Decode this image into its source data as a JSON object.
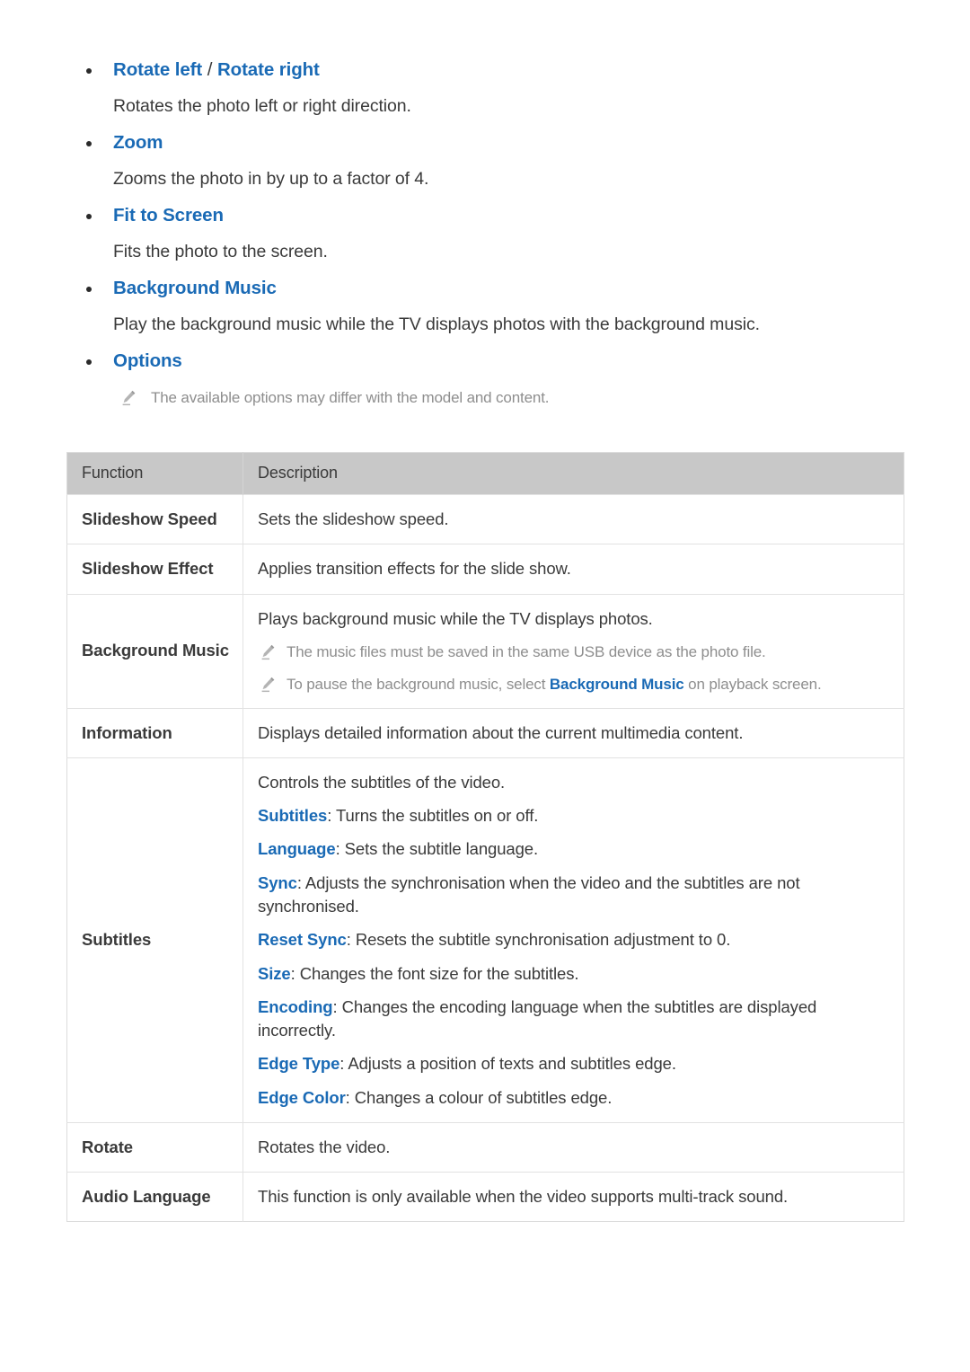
{
  "colors": {
    "accent_blue": "#1a6ab5",
    "body_text": "#3a3a3a",
    "note_text": "#8e8e8e",
    "table_header_bg": "#c8c8c8",
    "table_border": "#e2e2e2"
  },
  "sections": [
    {
      "title_a": "Rotate left",
      "separator": " / ",
      "title_b": "Rotate right",
      "body": "Rotates the photo left or right direction."
    },
    {
      "title_a": "Zoom",
      "body": "Zooms the photo in by up to a factor of 4."
    },
    {
      "title_a": "Fit to Screen",
      "body": "Fits the photo to the screen."
    },
    {
      "title_a": "Background Music",
      "body": "Play the background music while the TV displays photos with the background music."
    },
    {
      "title_a": "Options",
      "note": "The available options may differ with the model and content."
    }
  ],
  "table": {
    "headers": [
      "Function",
      "Description"
    ],
    "rows": [
      {
        "function": "Slideshow Speed",
        "lines": [
          "Sets the slideshow speed."
        ]
      },
      {
        "function": "Slideshow Effect",
        "lines": [
          "Applies transition effects for the slide show."
        ]
      },
      {
        "function": "Background Music",
        "lines": [
          "Plays background music while the TV displays photos."
        ],
        "notes": [
          {
            "text": "The music files must be saved in the same USB device as the photo file."
          },
          {
            "pre": "To pause the background music, select ",
            "emphasis": "Background Music",
            "post": " on playback screen."
          }
        ]
      },
      {
        "function": "Information",
        "lines": [
          "Displays detailed information about the current multimedia content."
        ]
      },
      {
        "function": "Subtitles",
        "lines": [
          "Controls the subtitles of the video."
        ],
        "keyed_lines": [
          {
            "key": "Subtitles",
            "text": ": Turns the subtitles on or off."
          },
          {
            "key": "Language",
            "text": ": Sets the subtitle language."
          },
          {
            "key": "Sync",
            "text": ": Adjusts the synchronisation when the video and the subtitles are not synchronised."
          },
          {
            "key": "Reset Sync",
            "text": ": Resets the subtitle synchronisation adjustment to 0."
          },
          {
            "key": "Size",
            "text": ": Changes the font size for the subtitles."
          },
          {
            "key": "Encoding",
            "text": ": Changes the encoding language when the subtitles are displayed incorrectly."
          },
          {
            "key": "Edge Type",
            "text": ": Adjusts a position of texts and subtitles edge."
          },
          {
            "key": "Edge Color",
            "text": ": Changes a colour of subtitles edge."
          }
        ]
      },
      {
        "function": "Rotate",
        "lines": [
          "Rotates the video."
        ]
      },
      {
        "function": "Audio Language",
        "lines": [
          "This function is only available when the video supports multi-track sound."
        ]
      }
    ]
  },
  "icons": {
    "note": "pencil-icon"
  }
}
